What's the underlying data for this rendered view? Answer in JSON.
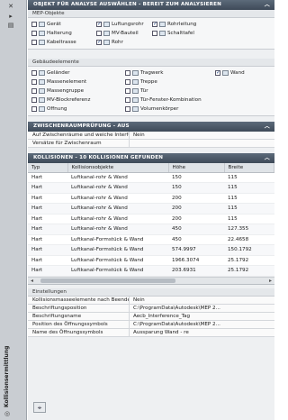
{
  "sidebar": {
    "vertical_title": "Kollisionsermittlung",
    "icons": [
      "close-icon",
      "pin-icon",
      "settings-icon"
    ]
  },
  "objects": {
    "header": "OBJEKT FÜR ANALYSE AUSWÄHLEN - BEREIT ZUM ANALYSIEREN",
    "mep_label": "MEP-Objekte",
    "mep_items": [
      {
        "label": "Gerät",
        "checked": false
      },
      {
        "label": "Luftungsrohr",
        "checked": true
      },
      {
        "label": "Rohrleitung",
        "checked": true
      },
      {
        "label": "Halterung",
        "checked": false
      },
      {
        "label": "MV-Bauteil",
        "checked": false
      },
      {
        "label": "Schalttafel",
        "checked": false
      },
      {
        "label": "Kabeltrasse",
        "checked": false
      },
      {
        "label": "Rohr",
        "checked": true
      }
    ],
    "building_label": "Gebäudeelemente",
    "building_items": [
      {
        "label": "Geländer",
        "checked": false
      },
      {
        "label": "Tragwerk",
        "checked": false
      },
      {
        "label": "Wand",
        "checked": true
      },
      {
        "label": "Massenelement",
        "checked": false
      },
      {
        "label": "Treppe",
        "checked": false
      },
      {
        "label": "Massengruppe",
        "checked": false
      },
      {
        "label": "Tür",
        "checked": false
      },
      {
        "label": "MV-Blockreferenz",
        "checked": false
      },
      {
        "label": "Tür-Fenster-Kombination",
        "checked": false
      },
      {
        "label": "Öffnung",
        "checked": false
      },
      {
        "label": "Volumenkörper",
        "checked": false
      }
    ]
  },
  "interference": {
    "header": "ZWISCHENRAUMPRÜFUNG - AUS",
    "rows": [
      {
        "key": "Auf Zwischenräume und weiche Interferenz...",
        "value": "Nein"
      },
      {
        "key": "Versätze für Zwischenraum",
        "value": ""
      }
    ]
  },
  "collisions": {
    "header": "KOLLISIONEN - 10 KOLLISIONEN GEFUNDEN",
    "columns": [
      "Typ",
      "Kollisionsobjekte",
      "Höhe",
      "Breite"
    ],
    "rows": [
      [
        "Hart",
        "Luftkanal-rohr & Wand",
        "150",
        "115"
      ],
      [
        "Hart",
        "Luftkanal-rohr & Wand",
        "150",
        "115"
      ],
      [
        "Hart",
        "Luftkanal-rohr & Wand",
        "200",
        "115"
      ],
      [
        "Hart",
        "Luftkanal-rohr & Wand",
        "200",
        "115"
      ],
      [
        "Hart",
        "Luftkanal-rohr & Wand",
        "200",
        "115"
      ],
      [
        "Hart",
        "Luftkanal-rohr & Wand",
        "450",
        "127.355"
      ],
      [
        "Hart",
        "Luftkanal-Formstück & Wand",
        "450",
        "22.4658"
      ],
      [
        "Hart",
        "Luftkanal-Formstück & Wand",
        "574.9997",
        "150.1792"
      ],
      [
        "Hart",
        "Luftkanal-Formstück & Wand",
        "1966.3074",
        "25.1792"
      ],
      [
        "Hart",
        "Luftkanal-Formstück & Wand",
        "203.6931",
        "25.1792"
      ]
    ]
  },
  "settings": {
    "header": "Einstellungen",
    "rows": [
      {
        "key": "Kollisionsmasseelemente nach Beenden des...",
        "value": "Nein"
      },
      {
        "key": "Beschriftungsposition",
        "value": "C:\\ProgramData\\Autodesk\\MEP 2..."
      },
      {
        "key": "Beschriftungsname",
        "value": "Aecb_Interference_Tag"
      },
      {
        "key": "Position des Öffnungssymbols",
        "value": "C:\\ProgramData\\Autodesk\\MEP 2..."
      },
      {
        "key": "Name des Öffnungssymbols",
        "value": "Aussparung Wand - re"
      }
    ]
  }
}
